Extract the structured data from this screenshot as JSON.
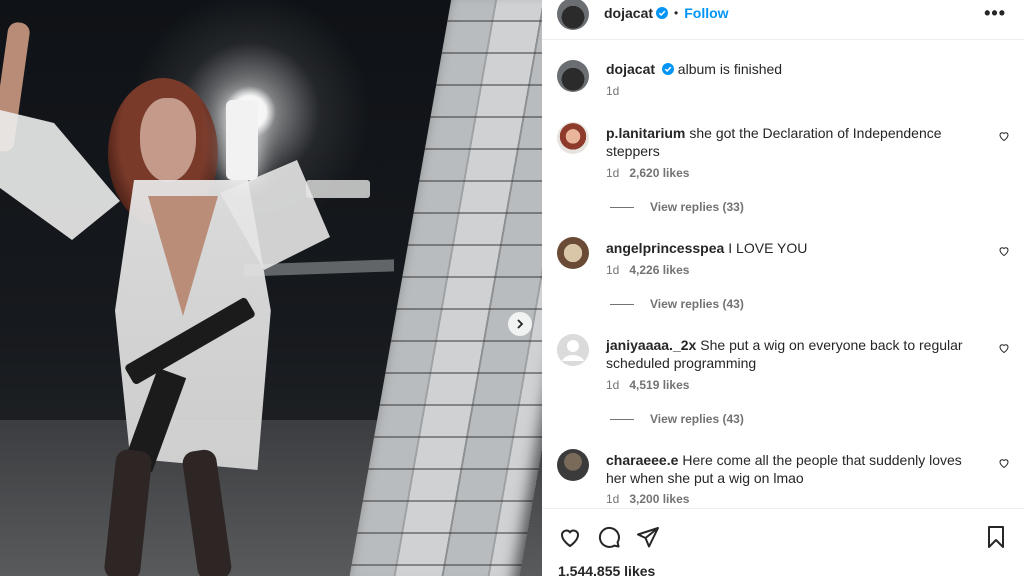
{
  "post": {
    "author": "dojacat",
    "follow_label": "Follow",
    "dot": "•",
    "more_label": "•••",
    "caption_text": "album is finished",
    "caption_time": "1d",
    "likes_total": "1,544,855 likes"
  },
  "comments": [
    {
      "username": "p.lanitarium",
      "text": "she got the Declaration of Independence steppers",
      "time": "1d",
      "likes": "2,620 likes",
      "replies": "View replies (33)"
    },
    {
      "username": "angelprincesspea",
      "text": "I LOVE YOU",
      "time": "1d",
      "likes": "4,226 likes",
      "replies": "View replies (43)"
    },
    {
      "username": "janiyaaaa._2x",
      "text": "She put a wig on everyone back to regular scheduled programming",
      "time": "1d",
      "likes": "4,519 likes",
      "replies": "View replies (43)"
    },
    {
      "username": "charaeee.e",
      "text": "Here come all the people that suddenly loves her when she put a wig on lmao",
      "time": "1d",
      "likes": "3,200 likes"
    }
  ],
  "colors": {
    "follow": "#0095f6",
    "verified": "#0095f6",
    "text": "#262626",
    "muted": "#737373"
  },
  "icons": {
    "carousel_next": "chevron-right-icon",
    "like": "heart-icon",
    "comment": "comment-icon",
    "share": "paper-plane-icon",
    "save": "bookmark-icon"
  }
}
